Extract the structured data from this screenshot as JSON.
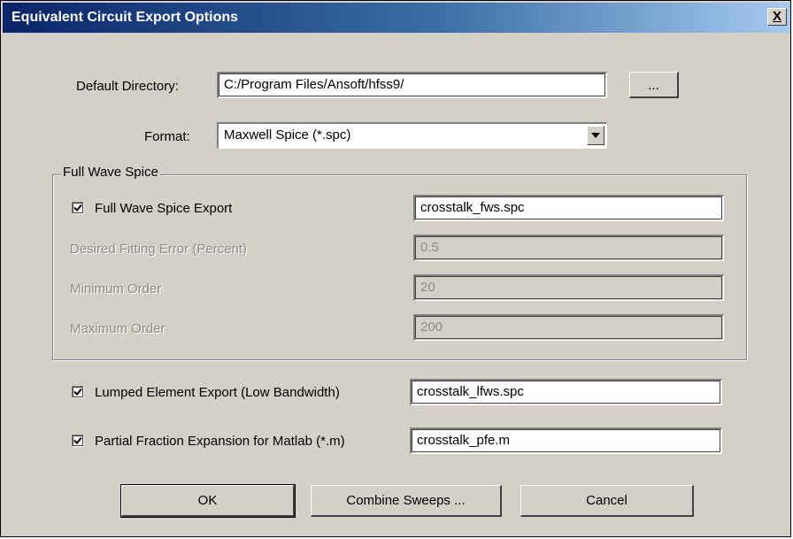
{
  "window": {
    "title": "Equivalent Circuit Export Options",
    "close_label": "X"
  },
  "default_directory": {
    "label": "Default Directory:",
    "value": "C:/Program Files/Ansoft/hfss9/",
    "browse_label": "..."
  },
  "format": {
    "label": "Format:",
    "selected": "Maxwell Spice (*.spc)"
  },
  "full_wave": {
    "group_title": "Full Wave Spice",
    "export": {
      "label": "Full Wave Spice Export",
      "checked": true,
      "value": "crosstalk_fws.spc"
    },
    "fitting_error": {
      "label": "Desired Fitting Error (Percent)",
      "value": "0.5"
    },
    "min_order": {
      "label": "Minimum Order",
      "value": "20"
    },
    "max_order": {
      "label": "Maximum Order",
      "value": "200"
    }
  },
  "lumped": {
    "label": "Lumped Element Export (Low Bandwidth)",
    "checked": true,
    "value": "crosstalk_lfws.spc"
  },
  "partial": {
    "label": "Partial Fraction Expansion for Matlab (*.m)",
    "checked": true,
    "value": "crosstalk_pfe.m"
  },
  "buttons": {
    "ok": "OK",
    "combine": "Combine Sweeps ...",
    "cancel": "Cancel"
  },
  "icons": {
    "checkmark": "checkmark-icon",
    "dropdown": "chevron-down-icon",
    "close": "close-icon"
  }
}
